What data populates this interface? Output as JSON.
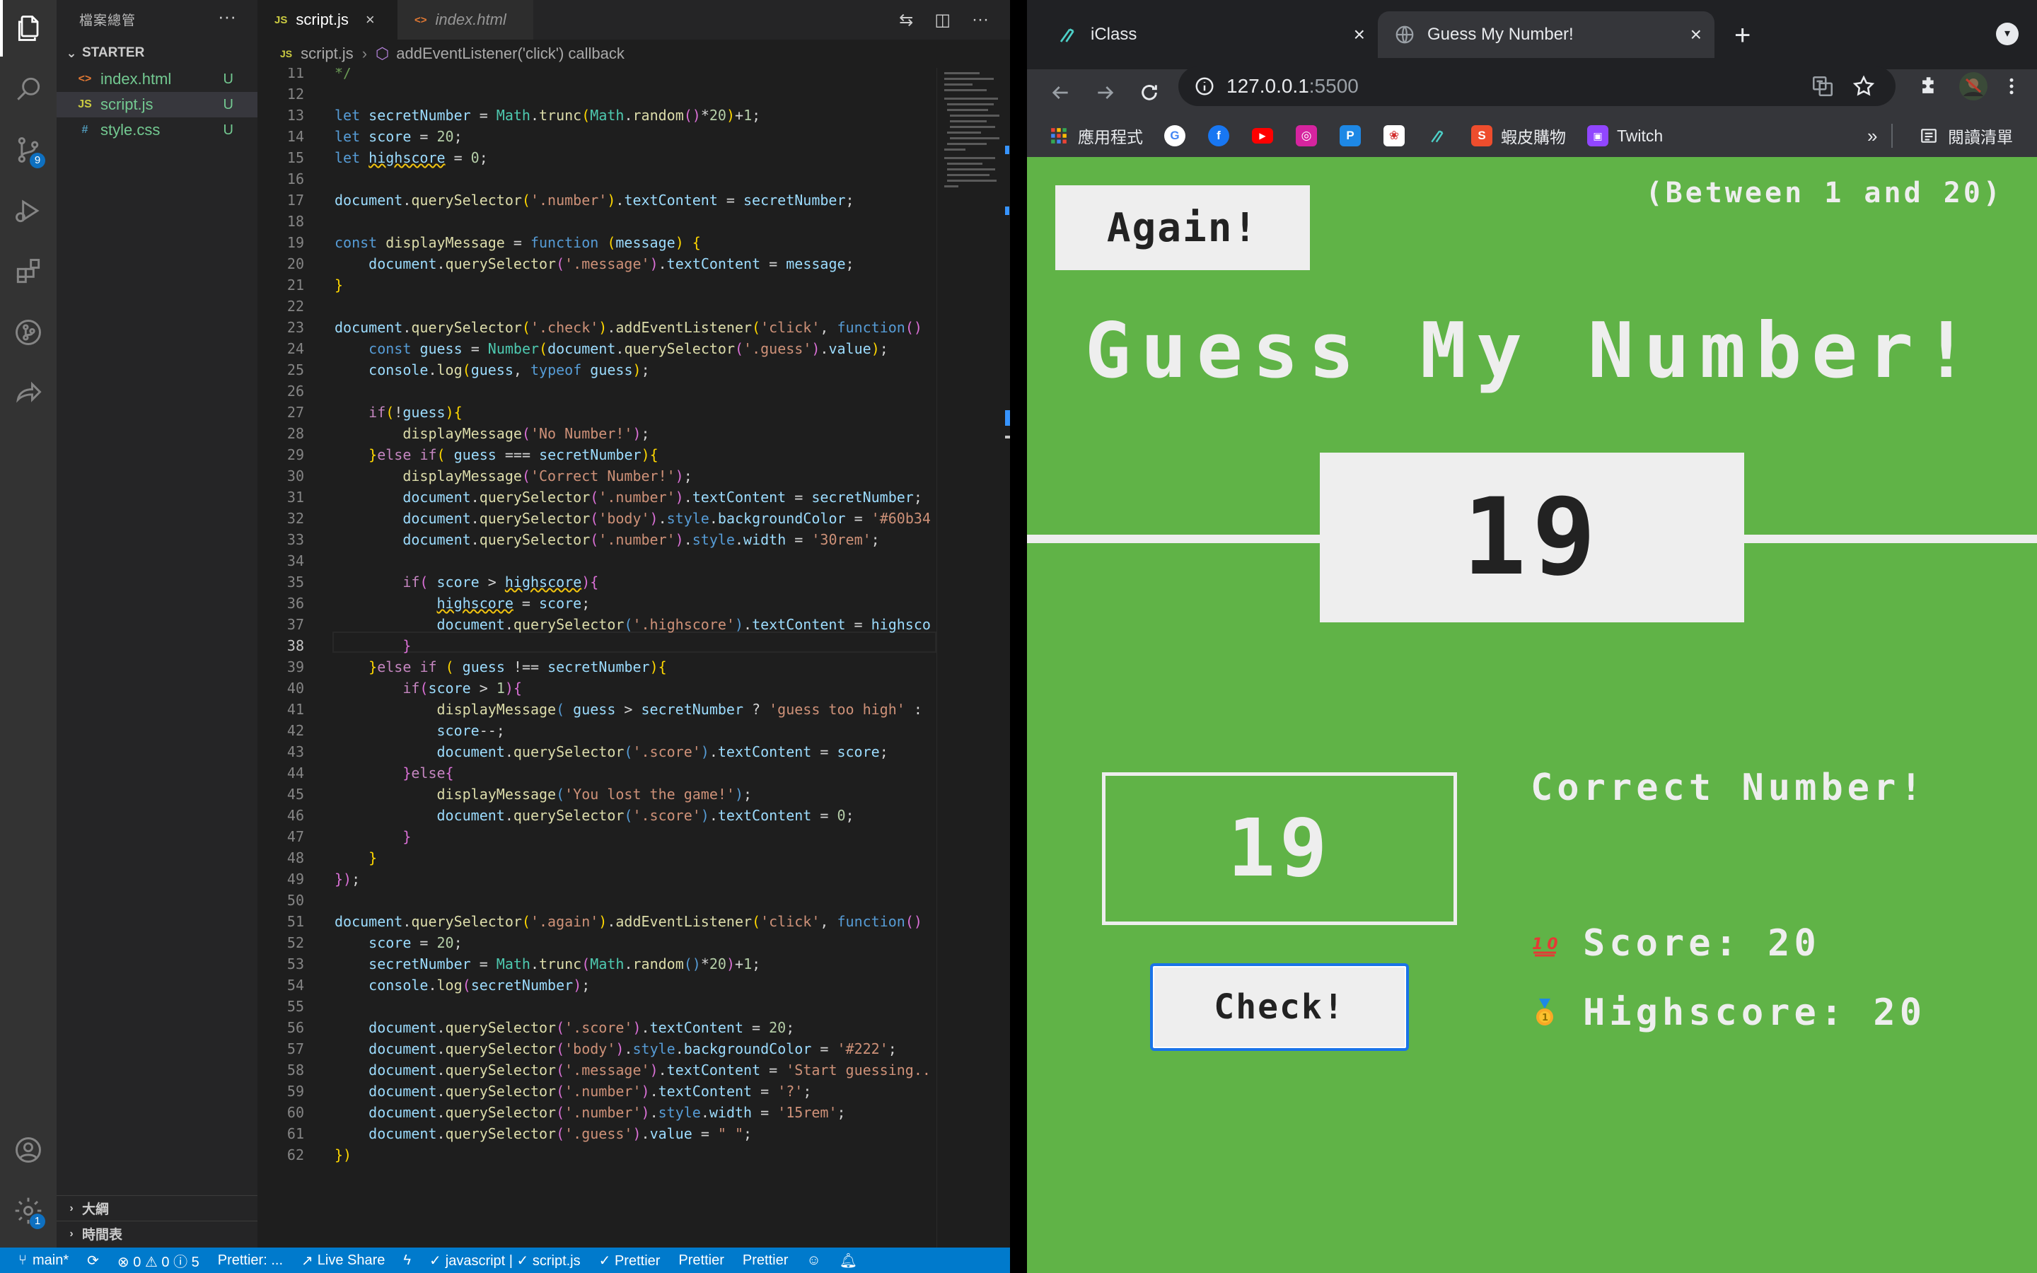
{
  "vscode": {
    "explorer_title": "檔案總管",
    "more_actions": "···",
    "folder": "STARTER",
    "files": [
      {
        "name": "index.html",
        "status": "U",
        "icon": "<>"
      },
      {
        "name": "script.js",
        "status": "U",
        "icon": "JS"
      },
      {
        "name": "style.css",
        "status": "U",
        "icon": "#"
      }
    ],
    "outline": "大綱",
    "timeline": "時間表",
    "scm_badge": "9",
    "settings_badge": "1",
    "tabs": [
      {
        "label": "script.js",
        "icon": "JS",
        "active": true
      },
      {
        "label": "index.html",
        "icon": "<>",
        "active": false
      }
    ],
    "breadcrumb": {
      "file": "script.js",
      "symbol": "addEventListener('click') callback"
    },
    "line_numbers": [
      "11",
      "12",
      "13",
      "14",
      "15",
      "16",
      "17",
      "18",
      "19",
      "20",
      "21",
      "22",
      "23",
      "24",
      "25",
      "26",
      "27",
      "28",
      "29",
      "30",
      "31",
      "32",
      "33",
      "34",
      "35",
      "36",
      "37",
      "38",
      "39",
      "40",
      "41",
      "42",
      "43",
      "44",
      "45",
      "46",
      "47",
      "48",
      "49",
      "50",
      "51",
      "52",
      "53",
      "54",
      "55",
      "56",
      "57",
      "58",
      "59",
      "60",
      "61",
      "62"
    ],
    "current_line": "38",
    "code_text": {
      "c11": "*/",
      "let": "let",
      "secretNumber": "secretNumber",
      "score": "score",
      "highscore": "highscore",
      "Math": "Math",
      "trunc": "trunc",
      "random": "random",
      "document": "document",
      "querySelector": "querySelector",
      "textContent": "textContent",
      "addEventListener": "addEventListener",
      "const": "const",
      "displayMessage": "displayMessage",
      "function": "function",
      "message": "message",
      "guess": "guess",
      "Number": "Number",
      "value": "value",
      "console": "console",
      "log": "log",
      "typeof": "typeof",
      "if": "if",
      "else": "else",
      "style": "style",
      "backgroundColor": "backgroundColor",
      "width": "width",
      "s_number": "'.number'",
      "s_message": "'.message'",
      "s_check": "'.check'",
      "s_click": "'click'",
      "s_guess": "'.guess'",
      "s_no": "'No Number!'",
      "s_correct": "'Correct Number!'",
      "s_body": "'body'",
      "s_color1": "'#60b34",
      "s_30rem": "'30rem'",
      "s_highscore": "'.highscore'",
      "s_toohigh": "'guess too high'",
      "s_score": "'.score'",
      "s_lost": "'You lost the game!'",
      "s_again": "'.again'",
      "s_222": "'#222'",
      "s_start": "'Start guessing..",
      "s_q": "'?'",
      "s_15rem": "'15rem'",
      "s_space": "\" \"",
      "n20": "20",
      "n1": "1",
      "n0": "0",
      "highsco": "highsco"
    }
  },
  "statusbar": {
    "branch": "main*",
    "problems": "⊗ 0 ⚠ 0 ⓘ 5",
    "prettier_trunc": "Prettier: ...",
    "live_share": "Live Share",
    "language": "javascript | ✓ script.js",
    "prettier1": "✓ Prettier",
    "prettier2": "Prettier",
    "prettier3": "Prettier"
  },
  "chrome": {
    "tabs": [
      {
        "title": "iClass",
        "active": false
      },
      {
        "title": "Guess My Number!",
        "active": true
      }
    ],
    "url_host": "127.0.0.1",
    "url_port": ":5500",
    "bookmarks": [
      {
        "label": "應用程式",
        "icon": "apps-grid-icon"
      },
      {
        "label": "",
        "icon": "google-icon"
      },
      {
        "label": "",
        "icon": "facebook-icon"
      },
      {
        "label": "",
        "icon": "youtube-icon"
      },
      {
        "label": "",
        "icon": "instagram-icon"
      },
      {
        "label": "",
        "icon": "p-app-icon"
      },
      {
        "label": "",
        "icon": "rose-icon"
      },
      {
        "label": "",
        "icon": "iclass-icon"
      },
      {
        "label": "蝦皮購物",
        "icon": "shopee-icon"
      },
      {
        "label": "Twitch",
        "icon": "twitch-icon"
      }
    ],
    "more_bookmarks": "»",
    "reading_list": "閱讀清單"
  },
  "game": {
    "again": "Again!",
    "between": "(Between 1 and 20)",
    "title": "Guess My Number!",
    "number": "19",
    "guess_value": "19",
    "check": "Check!",
    "message": "Correct Number!",
    "score_label": "Score:",
    "score": "20",
    "highscore_label": "Highscore:",
    "highscore": "20",
    "bg_color": "#60b347"
  }
}
